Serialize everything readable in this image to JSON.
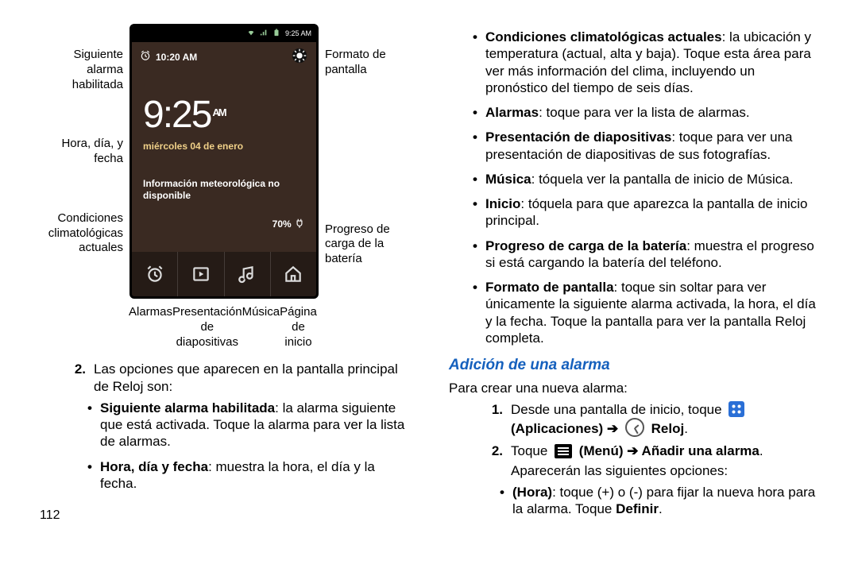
{
  "leftLabels": {
    "nextAlarm": "Siguiente alarma habilitada",
    "timeDate": "Hora, día, y fecha",
    "weather": "Condiciones climatológicas actuales"
  },
  "rightLabels": {
    "format": "Formato de pantalla",
    "battery": "Progreso de carga de la batería"
  },
  "phone": {
    "statusTime": "9:25 AM",
    "alarmTime": "10:20 AM",
    "bigTime": "9:25",
    "ampm": "AM",
    "date": "miércoles 04 de enero",
    "weather": "Información meteorológica no disponible",
    "battery": "70% "
  },
  "dockLabels": {
    "alarms": "Alarmas",
    "slideshow": "Presentación de diapositivas",
    "music": "Música",
    "home": "Página de inicio"
  },
  "left": {
    "n2": "2.",
    "n2text": "Las opciones que aparecen en la pantalla principal de Reloj son:",
    "b1_head": "Siguiente alarma habilitada",
    "b1_tail": ": la alarma siguiente que está activada. Toque la alarma para ver la lista de alarmas.",
    "b2_head": "Hora, día y fecha",
    "b2_tail": ": muestra la hora, el día y la fecha."
  },
  "right": {
    "b1_head": "Condiciones climatológicas actuales",
    "b1_tail": ": la ubicación y temperatura (actual, alta y baja). Toque esta área para ver más información del clima, incluyendo un pronóstico del tiempo de seis días.",
    "b2_head": "Alarmas",
    "b2_tail": ": toque para ver la lista de alarmas.",
    "b3_head": "Presentación de diapositivas",
    "b3_tail": ": toque para ver una presentación de diapositivas de sus fotografías.",
    "b4_head": "Música",
    "b4_tail": ": tóquela ver la pantalla de inicio de Música.",
    "b5_head": "Inicio",
    "b5_tail": ": tóquela para que aparezca la pantalla de inicio principal.",
    "b6_head": "Progreso de carga de la batería",
    "b6_tail": ": muestra el progreso si está cargando la batería del teléfono.",
    "b7_head": "Formato de pantalla",
    "b7_tail": ": toque sin soltar para ver únicamente la siguiente alarma activada, la hora, el día y la fecha. Toque la pantalla para ver la pantalla Reloj completa.",
    "h2": "Adición de una alarma",
    "intro": "Para crear una nueva alarma:",
    "s1n": "1.",
    "s1a": "Desde una pantalla de inicio, toque ",
    "s1b": " (Aplicaciones)",
    "s1c": " ➔ ",
    "s1d": " Reloj",
    "s1e": ".",
    "s2n": "2.",
    "s2a": "Toque ",
    "s2b": " (Menú) ➔ Añadir una alarma",
    "s2c": ".",
    "s2d": "Aparecerán las siguientes opciones:",
    "sub1_head": "(Hora)",
    "sub1_tail": ": toque (+) o (-) para fijar la nueva hora para la alarma. Toque ",
    "sub1_def": "Definir",
    "sub1_end": "."
  },
  "pageNumber": "112"
}
